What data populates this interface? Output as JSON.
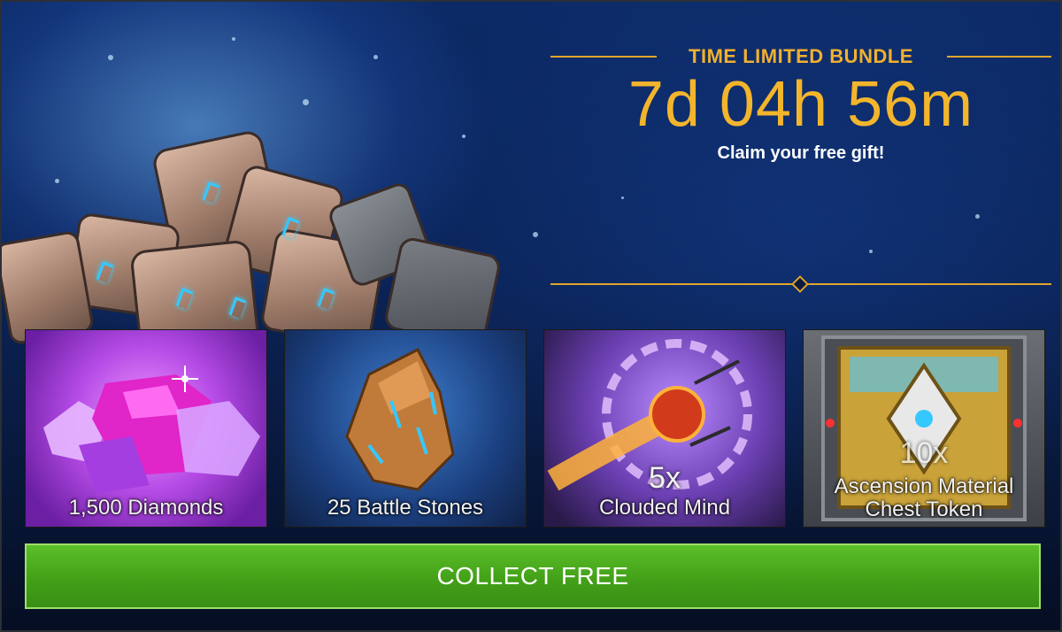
{
  "bundle": {
    "title": "TIME LIMITED BUNDLE",
    "timer": "7d 04h 56m",
    "subtitle": "Claim your free gift!"
  },
  "rewards": [
    {
      "qty": "",
      "label": "1,500 Diamonds",
      "icon": "diamonds-icon"
    },
    {
      "qty": "",
      "label": "25 Battle Stones",
      "icon": "battle-stone-icon"
    },
    {
      "qty": "5x",
      "label": "Clouded Mind",
      "icon": "clouded-mind-icon"
    },
    {
      "qty": "10x",
      "label_line1": "Ascension Material",
      "label_line2": "Chest Token",
      "icon": "chest-token-icon"
    }
  ],
  "collect_button": {
    "label": "COLLECT FREE"
  },
  "colors": {
    "accent_gold": "#f0b030",
    "button_green": "#43a018"
  }
}
